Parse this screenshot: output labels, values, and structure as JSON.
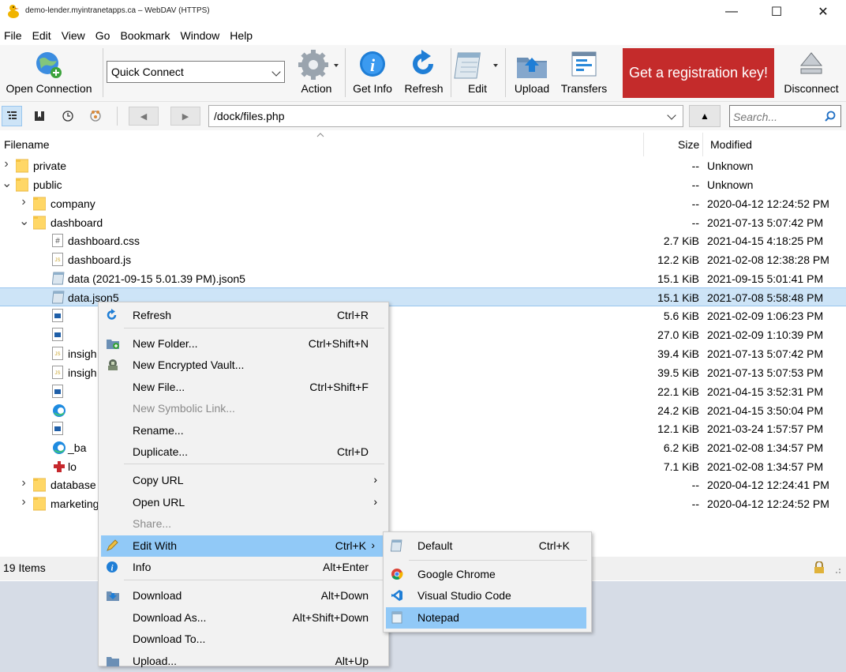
{
  "window": {
    "title": "demo-lender.myintranetapps.ca – WebDAV (HTTPS)",
    "minimize_glyph": "—",
    "maximize_glyph": "☐",
    "close_glyph": "✕"
  },
  "menubar": [
    "File",
    "Edit",
    "View",
    "Go",
    "Bookmark",
    "Window",
    "Help"
  ],
  "toolbar": {
    "open_connection": "Open Connection",
    "quick_connect": "Quick Connect",
    "action": "Action",
    "get_info": "Get Info",
    "refresh": "Refresh",
    "edit": "Edit",
    "upload": "Upload",
    "transfers": "Transfers",
    "registration": "Get a registration key!",
    "disconnect": "Disconnect",
    "registration_color": "#c42b2b"
  },
  "pathbar": {
    "path": "/dock/files.php",
    "search_placeholder": "Search...",
    "back_glyph": "◀",
    "forward_glyph": "▶",
    "up_glyph": "▲"
  },
  "columns": {
    "filename": "Filename",
    "size": "Size",
    "modified": "Modified"
  },
  "rows": [
    {
      "name": "private",
      "size": "--",
      "modified": "Unknown",
      "icon": "folder-icon",
      "chevron": "›"
    },
    {
      "name": "public",
      "size": "--",
      "modified": "Unknown",
      "icon": "folder-icon",
      "chevron": "⌄"
    },
    {
      "name": "company",
      "size": "--",
      "modified": "2020-04-12 12:24:52 PM",
      "icon": "folder-icon",
      "chevron": "›"
    },
    {
      "name": "dashboard",
      "size": "--",
      "modified": "2021-07-13 5:07:42 PM",
      "icon": "folder-icon",
      "chevron": "⌄"
    },
    {
      "name": "dashboard.css",
      "size": "2.7 KiB",
      "modified": "2021-04-15 4:18:25 PM",
      "icon": "css-file-icon"
    },
    {
      "name": "dashboard.js",
      "size": "12.2 KiB",
      "modified": "2021-02-08 12:38:28 PM",
      "icon": "js-file-icon"
    },
    {
      "name": "data (2021-09-15 5.01.39 PM).json5",
      "size": "15.1 KiB",
      "modified": "2021-09-15 5:01:41 PM",
      "icon": "notepad-file-icon"
    },
    {
      "name": "data.json5",
      "size": "15.1 KiB",
      "modified": "2021-07-08 5:58:48 PM",
      "icon": "notepad-file-icon",
      "selected": true
    },
    {
      "name": "",
      "size": "5.6 KiB",
      "modified": "2021-02-09 1:06:23 PM",
      "icon": "doc-file-icon"
    },
    {
      "name": "",
      "size": "27.0 KiB",
      "modified": "2021-02-09 1:10:39 PM",
      "icon": "doc-file-icon"
    },
    {
      "name": "insigh",
      "size": "39.4 KiB",
      "modified": "2021-07-13 5:07:42 PM",
      "icon": "js-file-icon"
    },
    {
      "name": "insigh",
      "size": "39.5 KiB",
      "modified": "2021-07-13 5:07:53 PM",
      "icon": "js-file-icon"
    },
    {
      "name": "",
      "size": "22.1 KiB",
      "modified": "2021-04-15 3:52:31 PM",
      "icon": "doc-file-icon"
    },
    {
      "name": "",
      "size": "24.2 KiB",
      "modified": "2021-04-15 3:50:04 PM",
      "icon": "edge-file-icon"
    },
    {
      "name": "",
      "size": "12.1 KiB",
      "modified": "2021-03-24 1:57:57 PM",
      "icon": "doc-file-icon"
    },
    {
      "name": "_ba",
      "size": "6.2 KiB",
      "modified": "2021-02-08 1:34:57 PM",
      "icon": "edge-file-icon"
    },
    {
      "name": "lo",
      "size": "7.1 KiB",
      "modified": "2021-02-08 1:34:57 PM",
      "icon": "puzzle-file-icon"
    },
    {
      "name": "database",
      "size": "--",
      "modified": "2020-04-12 12:24:41 PM",
      "icon": "folder-icon",
      "chevron": "›"
    },
    {
      "name": "marketing",
      "size": "--",
      "modified": "2020-04-12 12:24:52 PM",
      "icon": "folder-icon",
      "chevron": "›"
    }
  ],
  "status": {
    "items": "19 Items"
  },
  "context_menu": [
    {
      "label": "Refresh",
      "shortcut": "Ctrl+R",
      "icon": "refresh-icon"
    },
    {
      "label": "New Folder...",
      "shortcut": "Ctrl+Shift+N",
      "icon": "new-folder-icon"
    },
    {
      "label": "New Encrypted Vault...",
      "shortcut": "",
      "icon": "vault-icon"
    },
    {
      "label": "New File...",
      "shortcut": "Ctrl+Shift+F",
      "icon": ""
    },
    {
      "label": "New Symbolic Link...",
      "shortcut": "",
      "icon": "",
      "disabled": true
    },
    {
      "label": "Rename...",
      "shortcut": "",
      "icon": ""
    },
    {
      "label": "Duplicate...",
      "shortcut": "Ctrl+D",
      "icon": ""
    },
    {
      "label": "Copy URL",
      "shortcut": "",
      "submenu": true,
      "icon": ""
    },
    {
      "label": "Open URL",
      "shortcut": "",
      "submenu": true,
      "icon": ""
    },
    {
      "label": "Share...",
      "shortcut": "",
      "icon": "",
      "disabled": true
    },
    {
      "label": "Edit With",
      "shortcut": "Ctrl+K",
      "submenu": true,
      "icon": "pencil-icon",
      "highlighted": true
    },
    {
      "label": "Info",
      "shortcut": "Alt+Enter",
      "icon": "info-icon"
    },
    {
      "label": "Download",
      "shortcut": "Alt+Down",
      "icon": "download-icon"
    },
    {
      "label": "Download As...",
      "shortcut": "Alt+Shift+Down",
      "icon": ""
    },
    {
      "label": "Download To...",
      "shortcut": "",
      "icon": ""
    },
    {
      "label": "Upload...",
      "shortcut": "Alt+Up",
      "icon": "upload-icon"
    }
  ],
  "edit_with_submenu": [
    {
      "label": "Default",
      "shortcut": "Ctrl+K",
      "icon": "default-editor-icon"
    },
    {
      "label": "Google Chrome",
      "shortcut": "",
      "icon": "chrome-icon"
    },
    {
      "label": "Visual Studio Code",
      "shortcut": "",
      "icon": "vscode-icon"
    },
    {
      "label": "Notepad",
      "shortcut": "",
      "icon": "notepad-icon",
      "highlighted": true
    }
  ]
}
